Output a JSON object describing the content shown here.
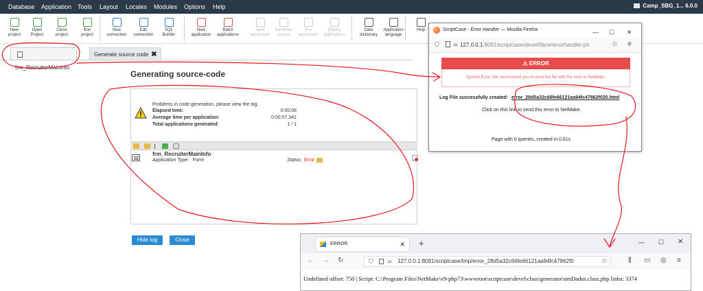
{
  "menu": {
    "items": [
      "Database",
      "Application",
      "Tools",
      "Layout",
      "Locales",
      "Modules",
      "Options",
      "Help"
    ],
    "project": "Camp_SBG_1... 6.0.0"
  },
  "toolbar": {
    "buttons": [
      {
        "l1": "New",
        "l2": "project",
        "color": "#49a04a"
      },
      {
        "l1": "Open",
        "l2": "Project",
        "color": "#49a04a"
      },
      {
        "l1": "Close",
        "l2": "project",
        "color": "#49a04a"
      },
      {
        "l1": "Run",
        "l2": "project",
        "color": "#49a04a"
      },
      {
        "l1": "New",
        "l2": "connection",
        "color": "#3a7fc4"
      },
      {
        "l1": "Edit",
        "l2": "connection",
        "color": "#3a7fc4"
      },
      {
        "l1": "SQL",
        "l2": "Builder",
        "color": "#3a7fc4"
      },
      {
        "l1": "New",
        "l2": "application",
        "color": "#d9534f"
      },
      {
        "l1": "Batch",
        "l2": "applications",
        "color": "#d9534f"
      },
      {
        "l1": "Save",
        "l2": "application",
        "color": "#cccccc"
      },
      {
        "l1": "Generate",
        "l2": "source",
        "color": "#cccccc"
      },
      {
        "l1": "Run",
        "l2": "application",
        "color": "#cccccc"
      },
      {
        "l1": "Deploy",
        "l2": "applications",
        "color": "#cccccc"
      },
      {
        "l1": "Data",
        "l2": "dictionary",
        "color": "#555555"
      },
      {
        "l1": "Application",
        "l2": "language",
        "color": "#555555"
      },
      {
        "l1": "Help",
        "l2": "",
        "color": "#555555"
      }
    ]
  },
  "tabs": {
    "tab1": "frm_RecruiterMainInfo",
    "tab2": "Generate source code",
    "close": "✖"
  },
  "gen": {
    "title": "Generating source-code",
    "message": "Problems in code generation, please view the log.",
    "elapsed_label": "Elapsed time:",
    "elapsed": "0:00:08",
    "avg_label": "Average time per application:",
    "avg": "0:00:07.341",
    "total_label": "Total applications generated:",
    "total": "1 / 1",
    "app_name": "frm_RecruiterMainInfo",
    "app_type_label": "Application Type:",
    "app_type": "Form",
    "status_label": "Status:",
    "status": "Error",
    "hide_log": "Hide log",
    "close": "Close"
  },
  "ff1": {
    "title": "ScriptCase - Error Handler — Mozilla Firefox",
    "url_host": "127.0.0.1",
    "url_rest": ":8091/scriptcase/devel/iface/errorhandler.ph",
    "error_heading": "⚠ ERROR",
    "error_msg": "System Error. We recommend you to send the file with the error to NetMake.",
    "log_label": "Log File successfully created:",
    "log_file": "error_28d5a32c66fe66121aa94fc47862f020.html",
    "click_text": "Click on this link to send this error to NetMake.",
    "footer": "Page with 0 queries, created in 0.61s"
  },
  "ff2": {
    "tab": "ERROR",
    "url": "127.0.0.1:8091/scriptcase/tmp/error_28d5a32c66fe66121aa94fc47862f0",
    "body": "Undefined offset: 750 | Script: C:\\Program Files\\NetMake\\v9-php73\\wwwroot\\scriptcase\\devel\\class\\generator\\nmDados.class.php linha: 3374"
  },
  "colors": {
    "menubar": "#2b3a4a",
    "accent": "#2b8ad4",
    "error": "#e74c4c",
    "annotation": "#e8141c"
  }
}
